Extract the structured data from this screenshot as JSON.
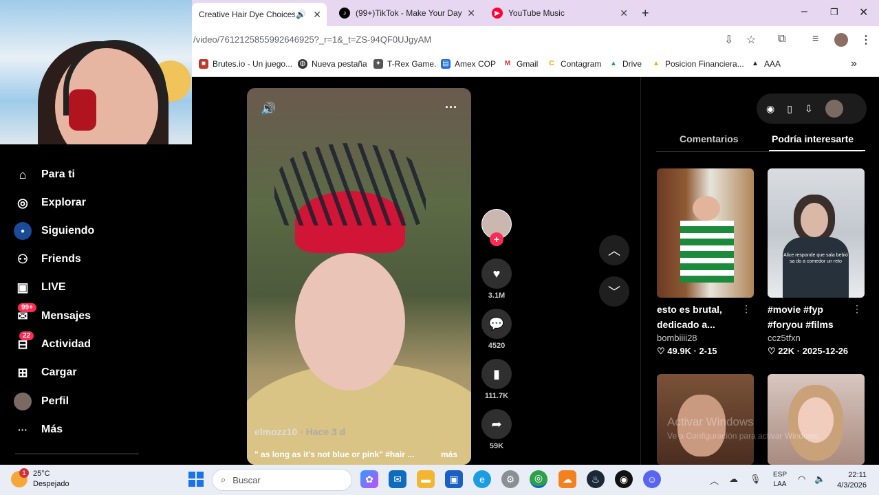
{
  "browser": {
    "tabs": [
      {
        "title": "Creative Hair Dye Choices: E",
        "active": true
      },
      {
        "title": "(99+)TikTok - Make Your Day",
        "active": false
      },
      {
        "title": "YouTube Music",
        "active": false
      }
    ],
    "new_tab": "+",
    "url": "/video/7612125855992646925?_r=1&_t=ZS-94QF0UJgyAM",
    "bookmarks": [
      "Brutes.io - Un juego...",
      "Nueva pestaña",
      "T-Rex Game.",
      "Amex COP",
      "Gmail",
      "Contagram",
      "Drive",
      "Posicion Financiera...",
      "AAA"
    ],
    "window_controls": {
      "minimize": "–",
      "maximize": "❐",
      "close": "✕"
    }
  },
  "sidebar": {
    "items": [
      {
        "label": "Para ti",
        "icon": "home-icon",
        "glyph": "⌂"
      },
      {
        "label": "Explorar",
        "icon": "compass-icon",
        "glyph": "◎"
      },
      {
        "label": "Siguiendo",
        "icon": "following-icon",
        "glyph": "●"
      },
      {
        "label": "Friends",
        "icon": "friends-icon",
        "glyph": "⚇"
      },
      {
        "label": "LIVE",
        "icon": "live-icon",
        "glyph": "▣"
      },
      {
        "label": "Mensajes",
        "icon": "messages-icon",
        "glyph": "✉",
        "badge": "99+"
      },
      {
        "label": "Actividad",
        "icon": "activity-icon",
        "glyph": "⊟",
        "badge": "22"
      },
      {
        "label": "Cargar",
        "icon": "upload-icon",
        "glyph": "⊞"
      },
      {
        "label": "Perfil",
        "icon": "profile-icon",
        "glyph": "◉"
      },
      {
        "label": "Más",
        "icon": "more-icon",
        "glyph": "···"
      }
    ]
  },
  "video": {
    "author": "elmozz10",
    "time": "· Hace 3 d",
    "description": "\" as long as it's not blue or pink\" #hair ...",
    "more": "más"
  },
  "actions": {
    "likes": "3.1M",
    "comments": "4520",
    "saves": "111.7K",
    "shares": "59K"
  },
  "right_panel": {
    "tabs": {
      "comments": "Comentarios",
      "suggested": "Podría interesarte"
    },
    "cards": [
      {
        "title": "esto es brutal, dedicado a...",
        "user": "bombiiii28",
        "stats": "♡ 49.9K · 2-15",
        "overlay": ""
      },
      {
        "title": "#movie #fyp #foryou #films",
        "user": "ccz5tfxn",
        "stats": "♡ 22K · 2025-12-26",
        "overlay": "Alice responde que sala bebió sa do a comedor un reto"
      },
      {
        "title": "",
        "user": "",
        "stats": "",
        "overlay": ""
      },
      {
        "title": "",
        "user": "",
        "stats": "",
        "overlay": ""
      }
    ]
  },
  "watermark": {
    "line1": "Activar Windows",
    "line2": "Ve a Configuración para activar Windows."
  },
  "taskbar": {
    "weather_temp": "25°C",
    "weather_desc": "Despejado",
    "weather_badge": "1",
    "search_placeholder": "Buscar",
    "lang_1": "ESP",
    "lang_2": "LAA",
    "time": "22:11",
    "date": "4/3/2026"
  }
}
